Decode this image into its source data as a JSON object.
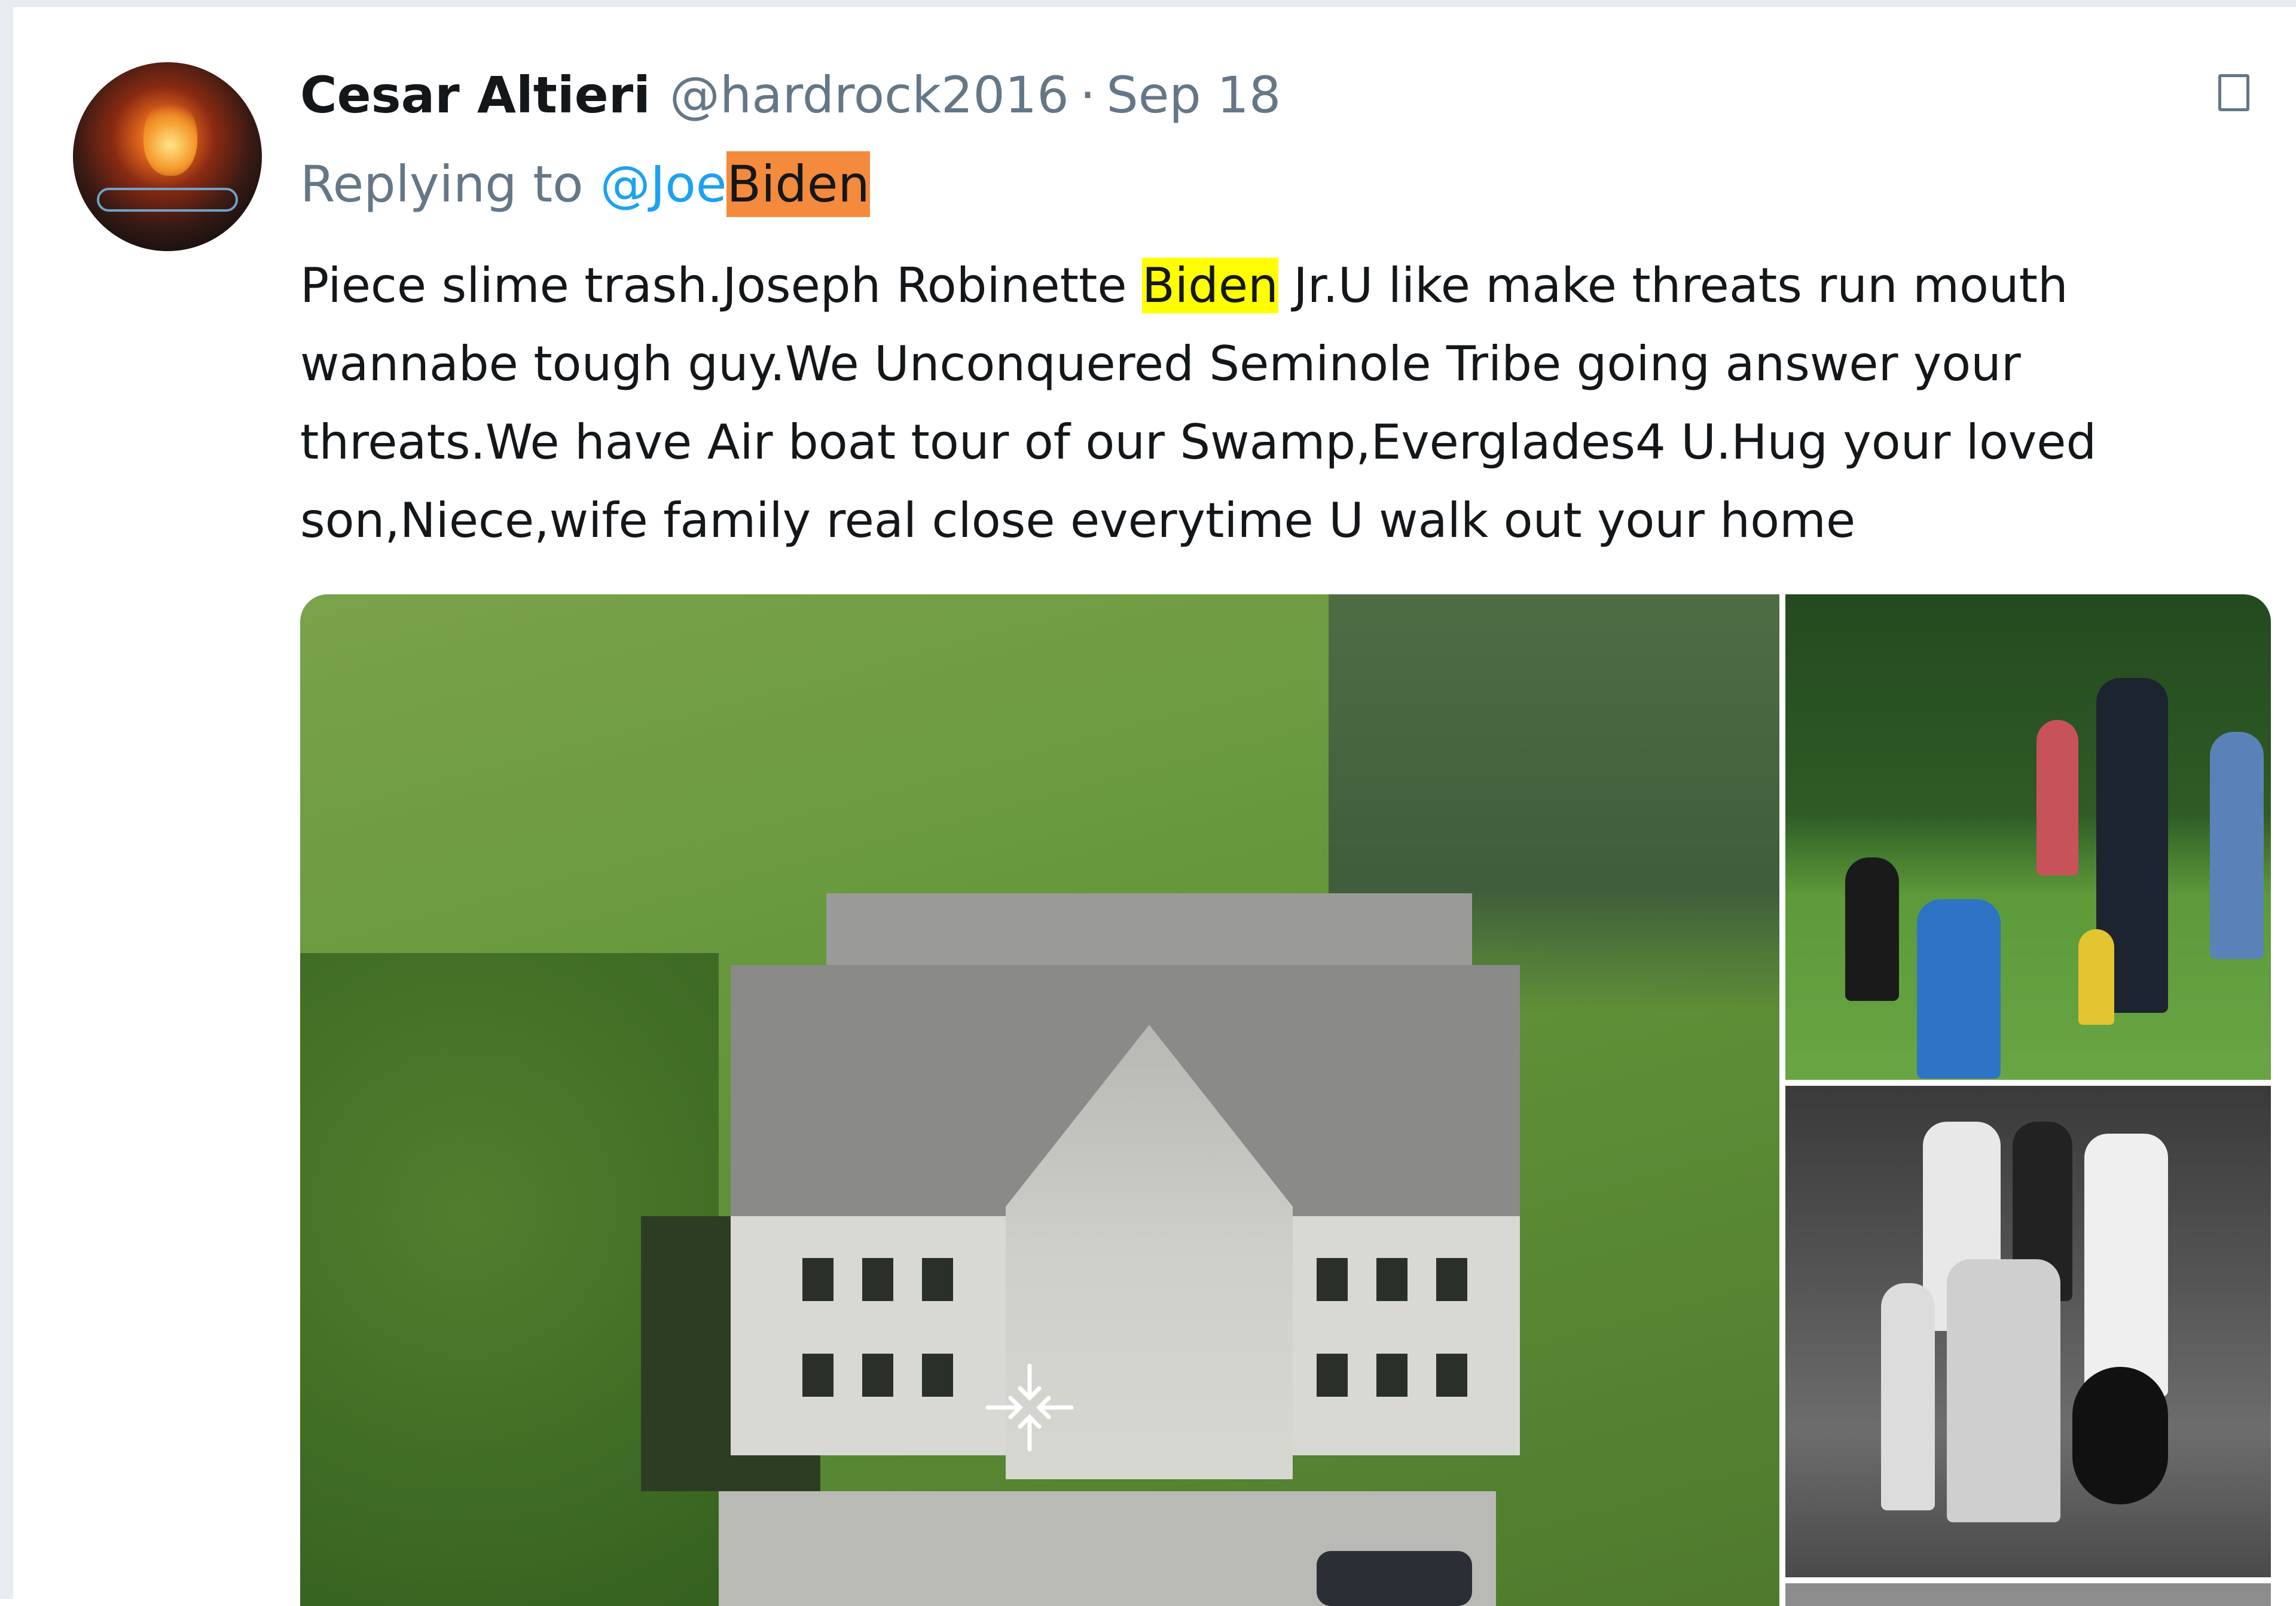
{
  "tweet": {
    "author_name": "Cesar Altieri",
    "handle": "@hardrock2016",
    "separator": "·",
    "date": "Sep 18",
    "reply_label": "Replying to",
    "mention_prefix": "@Joe",
    "mention_highlight": "Biden",
    "text_part1": "Piece slime trash.Joseph Robinette ",
    "text_highlight": "Biden",
    "text_part2": " Jr.U like make threats run mouth wannabe tough guy.We Unconquered Seminole Tribe going answer your threats.We have Air boat tour of our Swamp,Everglades4 U.Hug your loved son,Niece,wife family real close everytime U walk out your home"
  },
  "colors": {
    "link_blue": "#1da1f2",
    "mention_highlight": "#f48a3c",
    "text_highlight": "#ffff00",
    "secondary_text": "#657786",
    "primary_text": "#14171a"
  },
  "icons": {
    "caret": "chevron-down-icon",
    "expand": "expand-arrows-icon"
  }
}
